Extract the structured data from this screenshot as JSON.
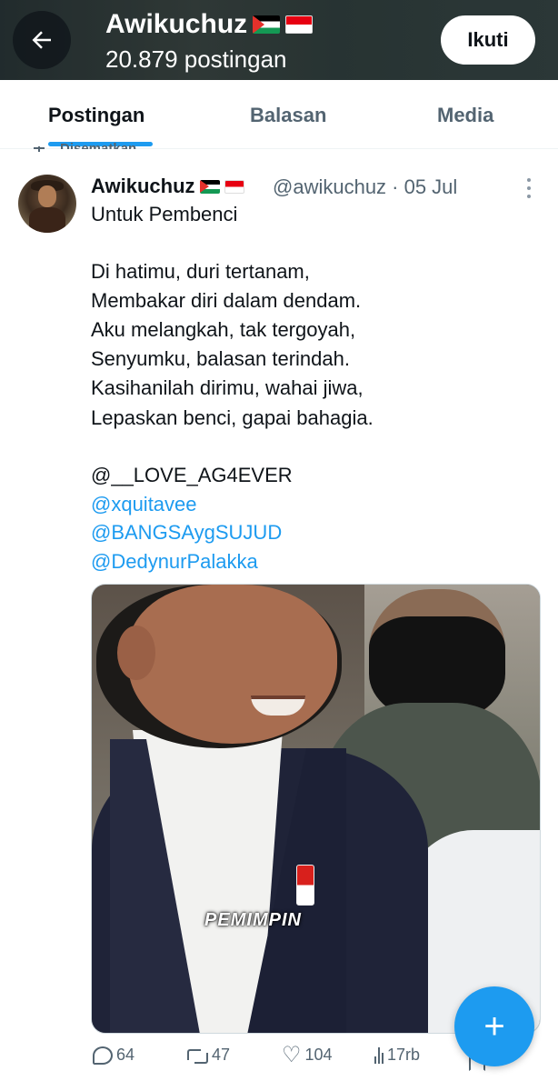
{
  "header": {
    "back_icon": "arrow-left-icon",
    "name": "Awikuchuz",
    "flags": [
      "palestine-flag",
      "indonesia-flag"
    ],
    "post_count": "20.879 postingan",
    "follow_label": "Ikuti"
  },
  "tabs": [
    {
      "label": "Postingan",
      "active": true
    },
    {
      "label": "Balasan",
      "active": false
    },
    {
      "label": "Media",
      "active": false
    }
  ],
  "pinned_label": "Disematkan",
  "tweet": {
    "name": "Awikuchuz",
    "handle": "@awikuchuz",
    "separator": "·",
    "date": "05 Jul",
    "meta": "@awikuchuz · 05 Jul",
    "lines": [
      "Untuk Pembenci",
      "Di hatimu, duri tertanam,",
      "Membakar diri dalam dendam.",
      "Aku melangkah, tak tergoyah,",
      "Senyumku, balasan terindah.",
      "Kasihanilah dirimu, wahai jiwa,",
      "Lepaskan benci, gapai bahagia.",
      "@__LOVE_AG4EVER"
    ],
    "mentions": [
      "@xquitavee",
      "@BANGSAygSUJUD",
      "@DedynurPalakka"
    ],
    "media_caption": "PEMIMPIN"
  },
  "actions": {
    "replies": "64",
    "reposts": "47",
    "likes": "104",
    "views": "17rb"
  },
  "colors": {
    "accent": "#1d9bf0",
    "text": "#0f1419",
    "muted": "#536471"
  }
}
